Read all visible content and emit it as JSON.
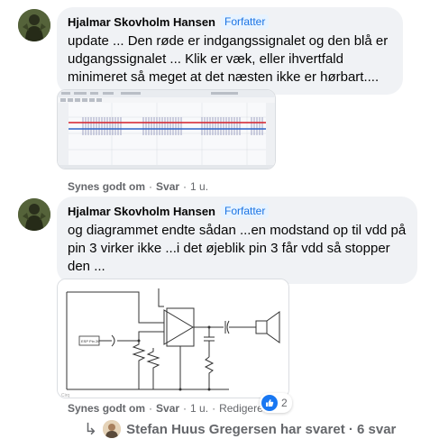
{
  "comments": [
    {
      "author": "Hjalmar Skovholm Hansen",
      "badge": "Forfatter",
      "text": "update ... Den røde er indgangssignalet og den blå er udgangssignalet ... Klik er væk, eller ihvertfald minimeret så meget at det næsten ikke er hørbart....",
      "actions": {
        "like": "Synes godt om",
        "reply": "Svar",
        "time": "1 u."
      }
    },
    {
      "author": "Hjalmar Skovholm Hansen",
      "badge": "Forfatter",
      "text": "og diagrammet endte sådan ...en modstand op til vdd på pin 3 virker ikke ...i det øjeblik pin 3 får vdd så stopper den ...",
      "actions": {
        "like": "Synes godt om",
        "reply": "Svar",
        "time": "1 u.",
        "edited": "Redigeret"
      },
      "reactions": {
        "icon": "like-icon",
        "count": "2"
      }
    }
  ],
  "replies": {
    "text": "Stefan Huus Gregersen har svaret · 6 svar"
  },
  "colors": {
    "accent": "#1877f2",
    "badge_text": "#1b74e4",
    "bubble_bg": "#f0f2f5",
    "meta_text": "#65676b",
    "signal_in": "#d4202b",
    "signal_out": "#2d64c8"
  }
}
